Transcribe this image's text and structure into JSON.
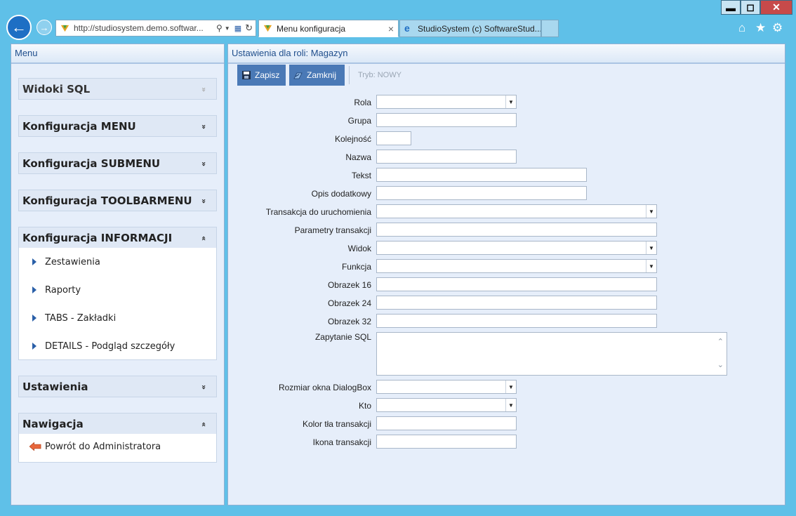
{
  "browser": {
    "address": "http://studiosystem.demo.softwar...",
    "tabs": [
      {
        "title": "Menu konfiguracja",
        "close": "×"
      },
      {
        "title": "StudioSystem (c) SoftwareStud..."
      }
    ],
    "window_controls": {
      "minimize": "▬",
      "maximize": "◻",
      "close": "✕"
    }
  },
  "left_panel": {
    "title": "Menu",
    "sections": [
      {
        "label": "Widoki SQL",
        "chevron": "»"
      },
      {
        "label": "Konfiguracja MENU",
        "chevron": "»"
      },
      {
        "label": "Konfiguracja SUBMENU",
        "chevron": "»"
      },
      {
        "label": "Konfiguracja TOOLBARMENU",
        "chevron": "»"
      },
      {
        "label": "Konfiguracja INFORMACJI",
        "chevron": "«"
      },
      {
        "label": "Ustawienia",
        "chevron": "»"
      },
      {
        "label": "Nawigacja",
        "chevron": "«"
      }
    ],
    "informacji_items": [
      "Zestawienia",
      "Raporty",
      "TABS - Zakładki",
      "DETAILS - Podgląd szczegóły"
    ],
    "nawigacja_items": [
      "Powrót do Administratora"
    ]
  },
  "right_panel": {
    "title": "Ustawienia dla roli: Magazyn",
    "toolbar": {
      "save": "Zapisz",
      "close": "Zamknij",
      "mode": "Tryb: NOWY"
    },
    "form": {
      "rola": "Rola",
      "grupa": "Grupa",
      "kolejnosc": "Kolejność",
      "nazwa": "Nazwa",
      "tekst": "Tekst",
      "opis": "Opis dodatkowy",
      "transakcja": "Transakcja do uruchomienia",
      "parametry": "Parametry transakcji",
      "widok": "Widok",
      "funkcja": "Funkcja",
      "obrazek16": "Obrazek 16",
      "obrazek24": "Obrazek 24",
      "obrazek32": "Obrazek 32",
      "zapytanie": "Zapytanie SQL",
      "rozmiar": "Rozmiar okna DialogBox",
      "kto": "Kto",
      "kolor": "Kolor tła transakcji",
      "ikona": "Ikona transakcji"
    }
  },
  "colors": {
    "accent": "#4a79b6",
    "panel_bg": "#e6eefa",
    "frame": "#5fc0e8"
  }
}
